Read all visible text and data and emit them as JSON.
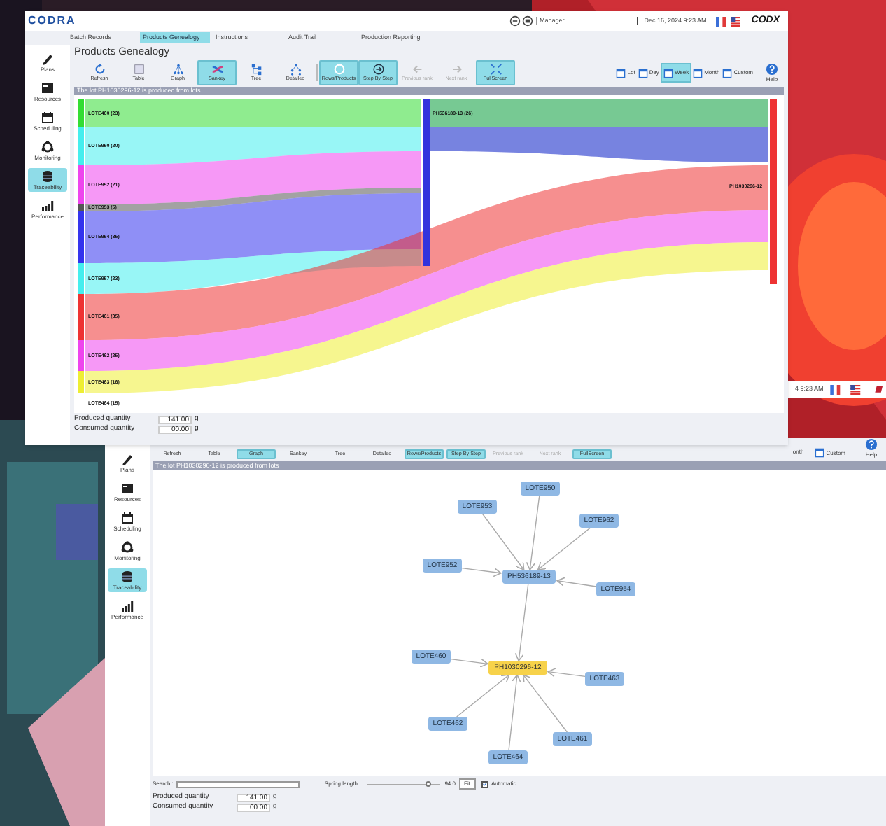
{
  "top_window": {
    "logo": "CODRA",
    "user": "Manager",
    "datetime": "Dec 16, 2024 9:23 AM",
    "brand": "CODX",
    "nav_tabs": [
      {
        "label": "Batch Records",
        "selected": false
      },
      {
        "label": "Products Genealogy",
        "selected": true
      },
      {
        "label": "Instructions",
        "selected": false
      },
      {
        "label": "Audit Trail",
        "selected": false
      },
      {
        "label": "Production Reporting",
        "selected": false
      }
    ],
    "page_title": "Products Genealogy",
    "toolbar": [
      {
        "label": "Refresh",
        "selected": false,
        "disabled": false
      },
      {
        "label": "Table",
        "selected": false,
        "disabled": false
      },
      {
        "label": "Graph",
        "selected": false,
        "disabled": false
      },
      {
        "label": "Sankey",
        "selected": true,
        "disabled": false
      },
      {
        "label": "Tree",
        "selected": false,
        "disabled": false
      },
      {
        "label": "Detailed",
        "selected": false,
        "disabled": false
      },
      {
        "label": "Rows/Products",
        "selected": true,
        "disabled": false
      },
      {
        "label": "Step By Step",
        "selected": true,
        "disabled": false
      },
      {
        "label": "Previous rank",
        "selected": false,
        "disabled": true
      },
      {
        "label": "Next rank",
        "selected": false,
        "disabled": true
      },
      {
        "label": "FullScreen",
        "selected": true,
        "disabled": false
      }
    ],
    "periods": [
      {
        "label": "Lot",
        "selected": false
      },
      {
        "label": "Day",
        "selected": false
      },
      {
        "label": "Week",
        "selected": true
      },
      {
        "label": "Month",
        "selected": false
      },
      {
        "label": "Custom",
        "selected": false
      }
    ],
    "help": "Help",
    "sidebar": [
      {
        "label": "Plans",
        "selected": false
      },
      {
        "label": "Resources",
        "selected": false
      },
      {
        "label": "Scheduling",
        "selected": false
      },
      {
        "label": "Monitoring",
        "selected": false
      },
      {
        "label": "Traceability",
        "selected": true
      },
      {
        "label": "Performance",
        "selected": false
      }
    ],
    "banner": "The lot PH1030296-12 is produced from lots",
    "sankey": {
      "sources": [
        {
          "label": "LOTE460 (23)",
          "color": "#33dd33"
        },
        {
          "label": "LOTE950 (20)",
          "color": "#44eeee"
        },
        {
          "label": "LOTE952 (21)",
          "color": "#ee44ee"
        },
        {
          "label": "LOTE953 (5)",
          "color": "#555555"
        },
        {
          "label": "LOTE954 (35)",
          "color": "#3333ee"
        },
        {
          "label": "LOTE957 (23)",
          "color": "#44eeee"
        },
        {
          "label": "LOTE461 (35)",
          "color": "#ee3333"
        },
        {
          "label": "LOTE462 (25)",
          "color": "#ee44ee"
        },
        {
          "label": "LOTE463 (16)",
          "color": "#eeee33"
        },
        {
          "label": "LOTE464 (15)"
        }
      ],
      "middle": "PH536189-13 (26)",
      "target": "PH1030296-12"
    },
    "produced_label": "Produced quantity",
    "produced_value": "141.00",
    "produced_unit": "g",
    "consumed_label": "Consumed quantity",
    "consumed_value": "00.00",
    "consumed_unit": "g"
  },
  "side_strip": {
    "time": "4 9:23 AM"
  },
  "bottom_window": {
    "sidebar": [
      {
        "label": "Plans",
        "selected": false
      },
      {
        "label": "Resources",
        "selected": false
      },
      {
        "label": "Scheduling",
        "selected": false
      },
      {
        "label": "Monitoring",
        "selected": false
      },
      {
        "label": "Traceability",
        "selected": true
      },
      {
        "label": "Performance",
        "selected": false
      }
    ],
    "toolbar": [
      {
        "label": "Refresh",
        "selected": false,
        "disabled": false
      },
      {
        "label": "Table",
        "selected": false,
        "disabled": false
      },
      {
        "label": "Graph",
        "selected": true,
        "disabled": false
      },
      {
        "label": "Sankey",
        "selected": false,
        "disabled": false
      },
      {
        "label": "Tree",
        "selected": false,
        "disabled": false
      },
      {
        "label": "Detailed",
        "selected": false,
        "disabled": false
      },
      {
        "label": "Rows/Products",
        "selected": true,
        "disabled": false
      },
      {
        "label": "Step By Step",
        "selected": true,
        "disabled": false
      },
      {
        "label": "Previous rank",
        "selected": false,
        "disabled": true
      },
      {
        "label": "Next rank",
        "selected": false,
        "disabled": true
      },
      {
        "label": "FullScreen",
        "selected": true,
        "disabled": false
      }
    ],
    "period_cut": "onth",
    "custom": "Custom",
    "help": "Help",
    "banner": "The lot PH1030296-12 is produced from lots",
    "graph_nodes": [
      {
        "label": "LOTE950",
        "kind": "lot"
      },
      {
        "label": "LOTE953",
        "kind": "lot"
      },
      {
        "label": "LOTE962",
        "kind": "lot"
      },
      {
        "label": "LOTE952",
        "kind": "lot"
      },
      {
        "label": "PH536189-13",
        "kind": "lot"
      },
      {
        "label": "LOTE954",
        "kind": "lot"
      },
      {
        "label": "LOTE460",
        "kind": "lot"
      },
      {
        "label": "PH1030296-12",
        "kind": "product"
      },
      {
        "label": "LOTE463",
        "kind": "lot"
      },
      {
        "label": "LOTE462",
        "kind": "lot"
      },
      {
        "label": "LOTE461",
        "kind": "lot"
      },
      {
        "label": "LOTE464",
        "kind": "lot"
      }
    ],
    "search_label": "Search :",
    "spring_label": "Spring length :",
    "spring": {
      "level": 0.85
    },
    "spring_value": "94.0",
    "fit": "Fit",
    "automatic": {
      "label": "Automatic",
      "checked": true
    },
    "produced_label": "Produced quantity",
    "produced_value": "141.00",
    "produced_unit": "g",
    "consumed_label": "Consumed quantity",
    "consumed_value": "00.00",
    "consumed_unit": "g"
  }
}
